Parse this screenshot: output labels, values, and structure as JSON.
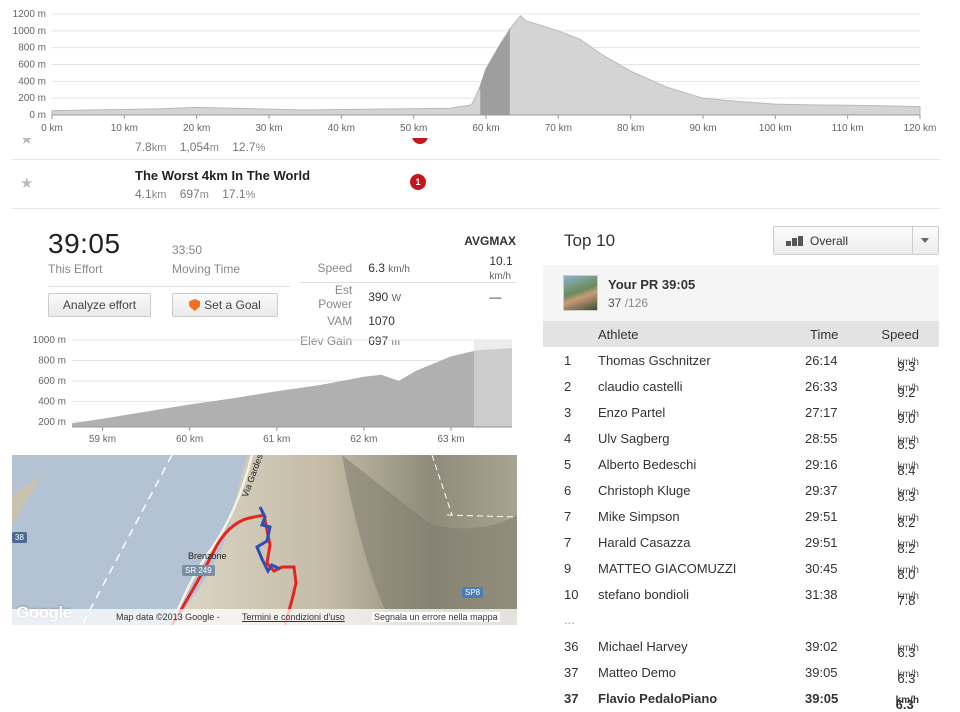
{
  "elevation_overview": {
    "y_ticks": [
      "1200 m",
      "1000 m",
      "800 m",
      "600 m",
      "400 m",
      "200 m",
      "0 m"
    ],
    "x_ticks": [
      "0 km",
      "10 km",
      "20 km",
      "30 km",
      "40 km",
      "50 km",
      "60 km",
      "70 km",
      "80 km",
      "90 km",
      "100 km",
      "110 km",
      "120 km"
    ]
  },
  "segments": [
    {
      "name": "",
      "distance": "7.8",
      "distance_unit": "km",
      "elevation": "1,054",
      "elevation_unit": "m",
      "grade": "12.7",
      "grade_unit": "%",
      "star": "★"
    },
    {
      "name": "The Worst 4km In The World",
      "distance": "4.1",
      "distance_unit": "km",
      "elevation": "697",
      "elevation_unit": "m",
      "grade": "17.1",
      "grade_unit": "%",
      "rank": "1",
      "star": "★"
    }
  ],
  "effort": {
    "time": "39:05",
    "time_label": "This Effort",
    "moving_time": "33:50",
    "moving_label": "Moving Time",
    "col_avg": "AVG",
    "col_max": "MAX",
    "stats": [
      {
        "label": "Speed",
        "avg": "6.3",
        "avg_unit": "km/h",
        "max": "10.1",
        "max_unit": "km/h"
      },
      {
        "label": "Est Power",
        "avg": "390",
        "avg_unit": "W",
        "max": "—",
        "max_unit": ""
      },
      {
        "label": "VAM",
        "avg": "1070",
        "avg_unit": "",
        "max": "",
        "max_unit": ""
      },
      {
        "label": "Elev Gain",
        "avg": "697",
        "avg_unit": "m",
        "max": "",
        "max_unit": ""
      }
    ],
    "analyze_button": "Analyze effort",
    "goal_button": "Set a Goal"
  },
  "segment_profile": {
    "y_ticks": [
      "1000 m",
      "800 m",
      "600 m",
      "400 m",
      "200 m"
    ],
    "x_ticks": [
      "59 km",
      "60 km",
      "61 km",
      "62 km",
      "63 km"
    ]
  },
  "map": {
    "labels": {
      "road": "Via Gardesana",
      "town": "Brenzone",
      "sr": "SR 249",
      "sp": "SP8",
      "left_badge": "38"
    },
    "logo": "Google",
    "footer_data": "Map data ©2013 Google -",
    "footer_terms": "Termini e condizioni d'uso",
    "footer_report": "Segnala un errore nella mappa"
  },
  "top10": {
    "title": "Top 10",
    "filter": "Overall",
    "pr_label": "Your PR 39:05",
    "pr_rank": "37",
    "pr_total": "/126",
    "headers": {
      "athlete": "Athlete",
      "time": "Time",
      "speed": "Speed"
    },
    "speed_unit": "km/h",
    "ellipsis": "...",
    "rows": [
      {
        "rank": "1",
        "name": "Thomas Gschnitzer",
        "time": "26:14",
        "speed": "9.3"
      },
      {
        "rank": "2",
        "name": "claudio castelli",
        "time": "26:33",
        "speed": "9.2"
      },
      {
        "rank": "3",
        "name": "Enzo Partel",
        "time": "27:17",
        "speed": "9.0"
      },
      {
        "rank": "4",
        "name": "Ulv Sagberg",
        "time": "28:55",
        "speed": "8.5"
      },
      {
        "rank": "5",
        "name": "Alberto Bedeschi",
        "time": "29:16",
        "speed": "8.4"
      },
      {
        "rank": "6",
        "name": "Christoph Kluge",
        "time": "29:37",
        "speed": "8.3"
      },
      {
        "rank": "7",
        "name": "Mike Simpson",
        "time": "29:51",
        "speed": "8.2"
      },
      {
        "rank": "7",
        "name": "Harald Casazza",
        "time": "29:51",
        "speed": "8.2"
      },
      {
        "rank": "9",
        "name": "MATTEO GIACOMUZZI",
        "time": "30:45",
        "speed": "8.0"
      },
      {
        "rank": "10",
        "name": "stefano bondioli",
        "time": "31:38",
        "speed": "7.8"
      }
    ],
    "extra_rows": [
      {
        "rank": "36",
        "name": "Michael Harvey",
        "time": "39:02",
        "speed": "6.3"
      },
      {
        "rank": "37",
        "name": "Matteo Demo",
        "time": "39:05",
        "speed": "6.3"
      },
      {
        "rank": "37",
        "name": "Flavio PedaloPiano",
        "time": "39:05",
        "speed": "6.3",
        "bold": true
      }
    ]
  }
}
